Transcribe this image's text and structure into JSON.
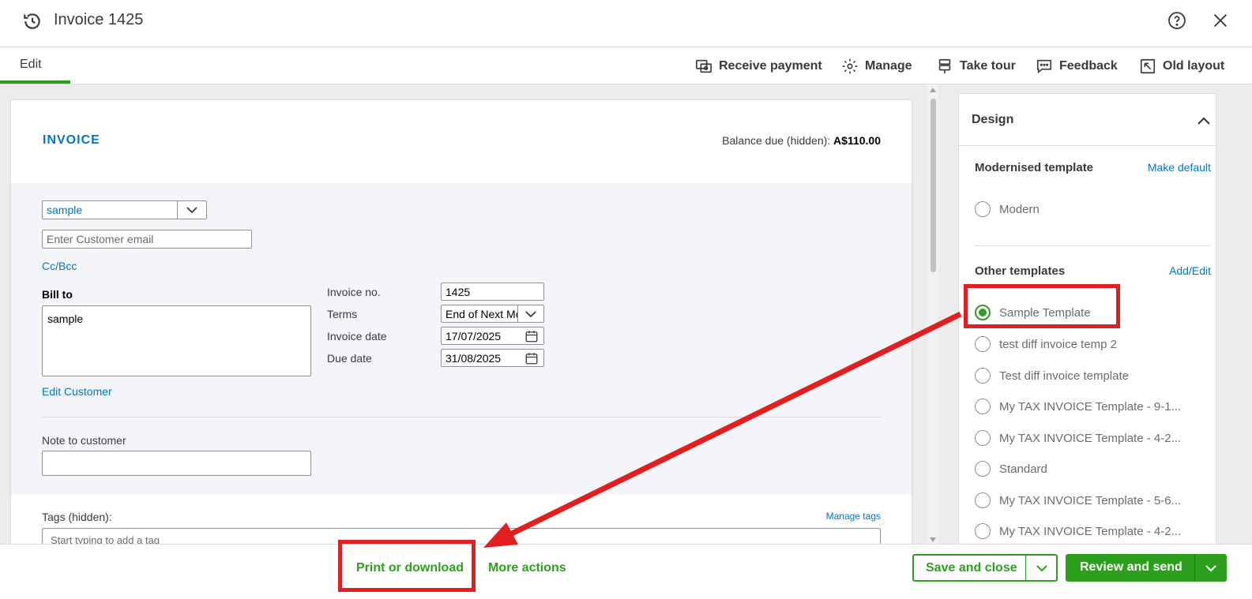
{
  "header": {
    "title": "Invoice 1425",
    "history_icon": "history-icon",
    "help_icon": "help-icon",
    "close_icon": "close-icon"
  },
  "toolbar": {
    "tab_edit": "Edit",
    "receive_payment": "Receive payment",
    "manage": "Manage",
    "take_tour": "Take tour",
    "feedback": "Feedback",
    "old_layout": "Old layout"
  },
  "invoice": {
    "heading": "INVOICE",
    "balance_label": "Balance due (hidden): ",
    "balance_value": "A$110.00",
    "customer_value": "sample",
    "email_placeholder": "Enter Customer email",
    "cc_bcc": "Cc/Bcc",
    "bill_to_label": "Bill to",
    "bill_to_value": "sample",
    "edit_customer": "Edit Customer",
    "invoice_no_label": "Invoice no.",
    "invoice_no_value": "1425",
    "terms_label": "Terms",
    "terms_value": "End of Next Mc",
    "invoice_date_label": "Invoice date",
    "invoice_date_value": "17/07/2025",
    "due_date_label": "Due date",
    "due_date_value": "31/08/2025",
    "note_label": "Note to customer",
    "note_value": "",
    "tags_label": "Tags (hidden):",
    "manage_tags": "Manage tags",
    "tags_placeholder": "Start typing to add a tag"
  },
  "design_panel": {
    "title": "Design",
    "modernised_title": "Modernised template",
    "make_default": "Make default",
    "modern_option": "Modern",
    "other_title": "Other templates",
    "add_edit": "Add/Edit",
    "templates": [
      {
        "label": "Sample Template",
        "selected": true
      },
      {
        "label": "test diff invoice temp 2",
        "selected": false
      },
      {
        "label": "Test diff invoice template",
        "selected": false
      },
      {
        "label": "My TAX INVOICE Template - 9-1...",
        "selected": false
      },
      {
        "label": "My TAX INVOICE Template - 4-2...",
        "selected": false
      },
      {
        "label": "Standard",
        "selected": false
      },
      {
        "label": "My TAX INVOICE Template - 5-6...",
        "selected": false
      },
      {
        "label": "My TAX INVOICE Template - 4-2...",
        "selected": false
      }
    ]
  },
  "footer": {
    "print_download": "Print or download",
    "more_actions": "More actions",
    "save_close": "Save and close",
    "review_send": "Review and send"
  },
  "colors": {
    "accent_green": "#2ca01c",
    "link_blue": "#0077c5",
    "annotation_red": "#e02020"
  }
}
